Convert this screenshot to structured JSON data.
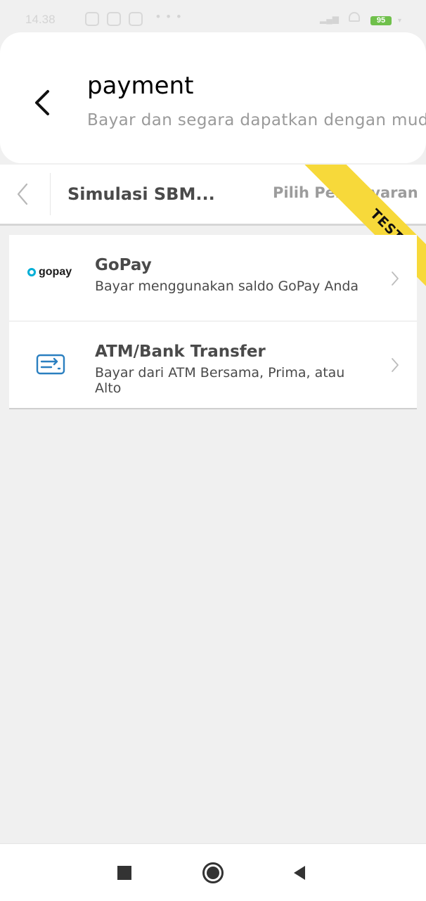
{
  "status_bar": {
    "time": "14.38",
    "battery": "95",
    "overflow_dots": "• • •"
  },
  "header": {
    "title": "payment",
    "subtitle": "Bayar dan segara dapatkan dengan mudah",
    "back_icon": "arrow-left-icon"
  },
  "toolbar": {
    "merchant": "Simulasi SBM...",
    "step": "Pilih Pembayaran",
    "back_icon": "chevron-left-icon"
  },
  "ribbon": {
    "label": "TEST",
    "color": "#f7d93a"
  },
  "payment_methods": [
    {
      "title": "GoPay",
      "description": "Bayar menggunakan saldo GoPay Anda",
      "logo_text": "gopay",
      "icon": "gopay-logo"
    },
    {
      "title": "ATM/Bank Transfer",
      "description": "Bayar dari ATM Bersama, Prima, atau Alto",
      "icon": "bank-card-icon"
    }
  ],
  "colors": {
    "accent_blue": "#2a7fc0",
    "gopay_blue": "#00aed6",
    "text_primary": "#4a4a4a",
    "background": "#f0f0f0"
  }
}
